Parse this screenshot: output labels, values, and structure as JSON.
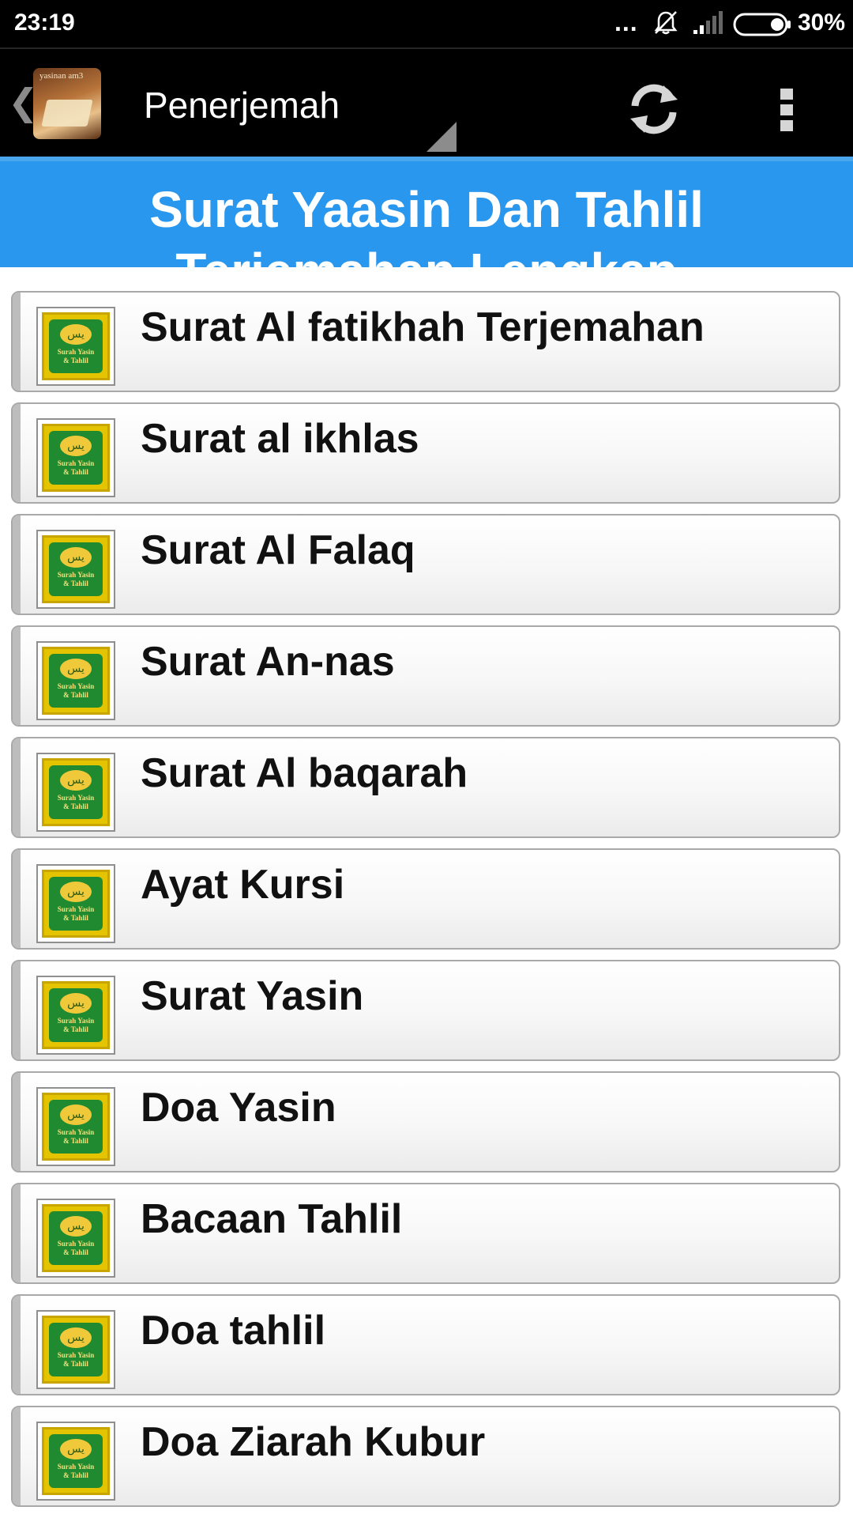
{
  "status_bar": {
    "time": "23:19",
    "dots": "...",
    "battery": "30%"
  },
  "action_bar": {
    "back_glyph": "❮",
    "app_icon_caption": "yasinan am3",
    "title": "Penerjemah",
    "icons": {
      "refresh": "refresh-icon",
      "overflow": "overflow-menu-icon"
    }
  },
  "banner": {
    "line1": "Surat Yaasin Dan Tahlil",
    "line2": "Terjemahan Lengkap"
  },
  "thumb": {
    "arabic": "يس",
    "caption_line1": "Surah Yasin",
    "caption_line2": "& Tahlil"
  },
  "list": {
    "items": [
      {
        "label": "Surat Al fatikhah Terjemahan"
      },
      {
        "label": "Surat al ikhlas"
      },
      {
        "label": "Surat Al Falaq"
      },
      {
        "label": "Surat An-nas"
      },
      {
        "label": "Surat Al baqarah"
      },
      {
        "label": "Ayat Kursi"
      },
      {
        "label": "Surat Yasin"
      },
      {
        "label": "Doa Yasin"
      },
      {
        "label": "Bacaan Tahlil"
      },
      {
        "label": "Doa tahlil"
      },
      {
        "label": "Doa Ziarah Kubur"
      }
    ]
  },
  "colors": {
    "banner": "#2a97ee",
    "bar": "#000000"
  }
}
